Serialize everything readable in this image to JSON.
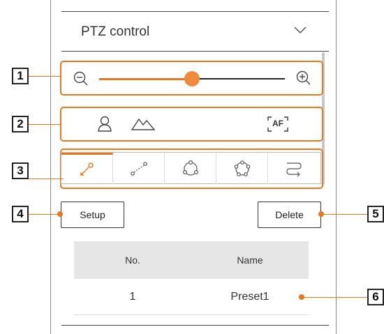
{
  "panel": {
    "title": "PTZ control"
  },
  "zoom": {
    "level_fraction": 0.5
  },
  "preset_table": {
    "columns": [
      "No.",
      "Name"
    ],
    "rows": [
      {
        "no": "1",
        "name": "Preset1"
      }
    ]
  },
  "buttons": {
    "setup": "Setup",
    "delete": "Delete"
  },
  "af_label": "AF",
  "callouts": [
    "1",
    "2",
    "3",
    "4",
    "5",
    "6"
  ],
  "colors": {
    "accent": "#e87722",
    "header_bg": "#e6e6e6"
  }
}
